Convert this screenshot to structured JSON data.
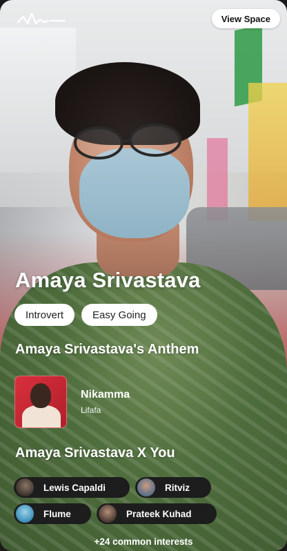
{
  "header": {
    "logo_icon": "soundwave-logo-icon",
    "view_space_label": "View Space"
  },
  "profile": {
    "name": "Amaya Srivastava",
    "tags": [
      "Introvert",
      "Easy Going"
    ]
  },
  "anthem": {
    "title": "Amaya Srivastava's Anthem",
    "song_title": "Nikamma",
    "song_artist": "Lifafa",
    "album_art_icon": "album-cover-image"
  },
  "common": {
    "title": "Amaya Srivastava X You",
    "artists": [
      {
        "name": "Lewis Capaldi"
      },
      {
        "name": "Ritviz"
      },
      {
        "name": "Flume"
      },
      {
        "name": "Prateek Kuhad"
      }
    ],
    "more_label": "+24 common interests"
  },
  "colors": {
    "accent_red": "#a52422",
    "chip_bg": "#1d1d1d",
    "pill_bg": "#ffffff"
  }
}
